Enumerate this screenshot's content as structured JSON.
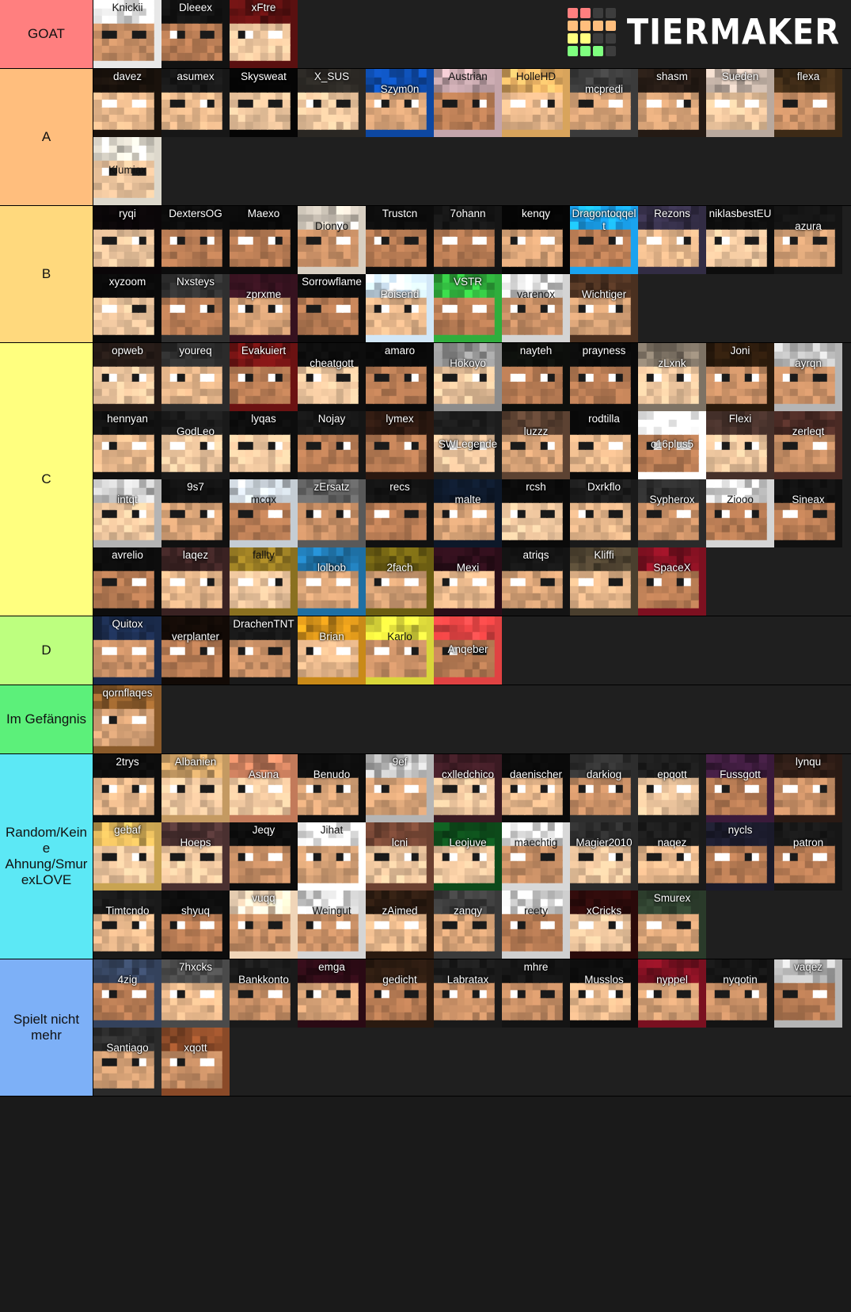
{
  "brand": {
    "name": "TIERMAKER",
    "logo_icon": "tiermaker-grid-logo",
    "logo_colors": [
      "#ff7f7f",
      "#ff7f7f",
      "#3d3d3d",
      "#3d3d3d",
      "#ffbe7d",
      "#ffbe7d",
      "#ffbe7d",
      "#ffbe7d",
      "#ffff7f",
      "#ffff7f",
      "#3d3d3d",
      "#3d3d3d",
      "#7fff7f",
      "#7fff7f",
      "#7fff7f",
      "#3d3d3d"
    ]
  },
  "tiers": [
    {
      "label": "GOAT",
      "color": "#ff7f7f",
      "items": [
        {
          "name": "Knickii",
          "bg": "#e8e8e8",
          "dark": true,
          "skin": "knickii"
        },
        {
          "name": "Dleeex",
          "bg": "#121212",
          "skin": "dleeex"
        },
        {
          "name": "xFtre",
          "bg": "#5a1010",
          "skin": "xftre"
        }
      ]
    },
    {
      "label": "A",
      "color": "#ffbe7d",
      "items": [
        {
          "name": "davez",
          "bg": "#1a120c",
          "skin": "davez"
        },
        {
          "name": "asumex",
          "bg": "#171717",
          "skin": "asumex"
        },
        {
          "name": "Skysweat",
          "bg": "#050505",
          "skin": "skysweat"
        },
        {
          "name": "X_SUS",
          "bg": "#2a2723",
          "skin": "xsus"
        },
        {
          "name": "Szym0n",
          "bg": "#0d47a1",
          "skin": "szymon",
          "pos": "low"
        },
        {
          "name": "Austrian",
          "bg": "#c4a5ab",
          "dark": true,
          "skin": "austrian"
        },
        {
          "name": "HolleHD",
          "bg": "#d8a45c",
          "dark": true,
          "skin": "hollehd"
        },
        {
          "name": "mcpredi",
          "bg": "#3b3b3b",
          "skin": "mcpredi",
          "pos": "low"
        },
        {
          "name": "shasm",
          "bg": "#241a14",
          "skin": "shasm"
        },
        {
          "name": "Sueden",
          "bg": "#b9a99e",
          "skin": "sueden"
        },
        {
          "name": "flexa",
          "bg": "#3d2a16",
          "skin": "flexa"
        },
        {
          "name": "Klumiax",
          "bg": "#ddd8cc",
          "dark": true,
          "skin": "klumiax",
          "pos": "lower"
        }
      ]
    },
    {
      "label": "B",
      "color": "#ffd97d",
      "items": [
        {
          "name": "ryqi",
          "bg": "#0a0608",
          "skin": "ryqi"
        },
        {
          "name": "DextersOG",
          "bg": "#0c0c0c",
          "skin": "dextersog"
        },
        {
          "name": "Maexo",
          "bg": "#090909",
          "skin": "maexo"
        },
        {
          "name": "Dionyo",
          "bg": "#d8cfc2",
          "dark": true,
          "skin": "dionyo",
          "pos": "low"
        },
        {
          "name": "Trustcn",
          "bg": "#0c0c0c",
          "skin": "trustcn"
        },
        {
          "name": "7ohann",
          "bg": "#151515",
          "skin": "7ohann"
        },
        {
          "name": "kenqy",
          "bg": "#050505",
          "skin": "kenqy"
        },
        {
          "name": "Dragontoqqelt",
          "bg": "#1aa3f0",
          "skin": "dragontoqqelt"
        },
        {
          "name": "Rezons",
          "bg": "#322c44",
          "skin": "rezons"
        },
        {
          "name": "niklasbestEU",
          "bg": "#0d0d0d",
          "skin": "niklasbesteu"
        },
        {
          "name": "azura",
          "bg": "#141414",
          "skin": "azura",
          "pos": "low"
        },
        {
          "name": "xyzoom",
          "bg": "#0a0a0a",
          "skin": "xyzoom"
        },
        {
          "name": "Nxsteys",
          "bg": "#2f2f2f",
          "skin": "nxsteys"
        },
        {
          "name": "zprxme",
          "bg": "#36121f",
          "skin": "zprxme",
          "pos": "low"
        },
        {
          "name": "Sorrowflame",
          "bg": "#0b0b0b",
          "skin": "sorrowflame"
        },
        {
          "name": "Poisend",
          "bg": "#d2e7f7",
          "skin": "poisend",
          "pos": "low"
        },
        {
          "name": "VSTR",
          "bg": "#2fae3c",
          "skin": "vstr"
        },
        {
          "name": "varenox",
          "bg": "#d4d4d4",
          "dark": true,
          "skin": "varenox",
          "pos": "low"
        },
        {
          "name": "Wichtiger",
          "bg": "#4a3020",
          "skin": "wichtiger",
          "pos": "low"
        }
      ]
    },
    {
      "label": "C",
      "color": "#ffff7f",
      "items": [
        {
          "name": "opweb",
          "bg": "#241a16",
          "skin": "opweb"
        },
        {
          "name": "youreq",
          "bg": "#2b2b2b",
          "skin": "youreq"
        },
        {
          "name": "Evakuiert",
          "bg": "#6b1212",
          "skin": "evakuiert"
        },
        {
          "name": "cheatgott",
          "bg": "#0d0d0d",
          "skin": "cheatgott",
          "pos": "low"
        },
        {
          "name": "amaro",
          "bg": "#0a0a0a",
          "skin": "amaro"
        },
        {
          "name": "Hokoyo",
          "bg": "#8c8c8c",
          "skin": "hokoyo",
          "pos": "low"
        },
        {
          "name": "nayteh",
          "bg": "#0d0f0c",
          "skin": "nayteh"
        },
        {
          "name": "prayness",
          "bg": "#0a0a0a",
          "skin": "prayness"
        },
        {
          "name": "zLxnk",
          "bg": "#7d7264",
          "skin": "zlxnk",
          "pos": "low"
        },
        {
          "name": "Joni",
          "bg": "#2a1a0c",
          "skin": "joni"
        },
        {
          "name": "ayrqn",
          "bg": "#b5b5b5",
          "skin": "ayrqn",
          "pos": "low"
        },
        {
          "name": "hennyan",
          "bg": "#111111",
          "skin": "hennyan"
        },
        {
          "name": "GodLeo",
          "bg": "#1a1a1a",
          "skin": "godleo",
          "pos": "low"
        },
        {
          "name": "lyqas",
          "bg": "#0d0d0d",
          "skin": "lyqas"
        },
        {
          "name": "Nojay",
          "bg": "#151515",
          "skin": "nojay"
        },
        {
          "name": "lymex",
          "bg": "#2b1810",
          "skin": "lymex"
        },
        {
          "name": "SWLegende",
          "bg": "#1d1d1d",
          "skin": "swlegende",
          "pos": "lower"
        },
        {
          "name": "luzzz",
          "bg": "#5c4232",
          "skin": "luzzz",
          "pos": "low"
        },
        {
          "name": "rodtilla",
          "bg": "#0a0a0a",
          "skin": "rodtilla"
        },
        {
          "name": "c16plus5",
          "bg": "#ffffff",
          "skin": "c16plus5",
          "pos": "lower"
        },
        {
          "name": "Flexi",
          "bg": "#45302a",
          "skin": "flexi"
        },
        {
          "name": "zerleqt",
          "bg": "#4a2a24",
          "skin": "zerleqt",
          "pos": "low"
        },
        {
          "name": "intqt",
          "bg": "#b4b4b4",
          "skin": "intqt",
          "pos": "low"
        },
        {
          "name": "9s7",
          "bg": "#111111",
          "skin": "9s7"
        },
        {
          "name": "mcqx",
          "bg": "#c5cdd4",
          "dark": true,
          "skin": "mcqx",
          "pos": "low"
        },
        {
          "name": "zErsatz",
          "bg": "#595959",
          "skin": "zersatz"
        },
        {
          "name": "recs",
          "bg": "#111111",
          "skin": "recs"
        },
        {
          "name": "malte",
          "bg": "#0d1829",
          "skin": "malte",
          "pos": "low"
        },
        {
          "name": "rcsh",
          "bg": "#0a0a0a",
          "skin": "rcsh"
        },
        {
          "name": "Dxrkflo",
          "bg": "#1a1a1a",
          "skin": "dxrkflo"
        },
        {
          "name": "Sypherox",
          "bg": "#2a2a2a",
          "skin": "sypherox",
          "pos": "low"
        },
        {
          "name": "Ziooo",
          "bg": "#d5d5d5",
          "dark": true,
          "skin": "ziooo",
          "pos": "low"
        },
        {
          "name": "Sineax",
          "bg": "#101010",
          "skin": "sineax",
          "pos": "low"
        },
        {
          "name": "avrelio",
          "bg": "#0d0d0d",
          "skin": "avrelio"
        },
        {
          "name": "laqez",
          "bg": "#3a2222",
          "skin": "laqez"
        },
        {
          "name": "fallty",
          "bg": "#8a7020",
          "dark": true,
          "skin": "fallty"
        },
        {
          "name": "lolbob",
          "bg": "#1e6fa3",
          "skin": "lolbob",
          "pos": "low"
        },
        {
          "name": "2fach",
          "bg": "#6b5d12",
          "skin": "2fach",
          "pos": "low"
        },
        {
          "name": "Mexi",
          "bg": "#2a0d18",
          "skin": "mexi",
          "pos": "low"
        },
        {
          "name": "atriqs",
          "bg": "#141414",
          "skin": "atriqs"
        },
        {
          "name": "Kliffi",
          "bg": "#4a3f2e",
          "skin": "kliffi"
        },
        {
          "name": "SpaceX",
          "bg": "#7d1020",
          "skin": "spacex",
          "pos": "low"
        }
      ]
    },
    {
      "label": "D",
      "color": "#bdff7f",
      "items": [
        {
          "name": "Quitox",
          "bg": "#1a2a4a",
          "skin": "quitox"
        },
        {
          "name": "verplanter",
          "bg": "#120a06",
          "skin": "verplanter",
          "pos": "low"
        },
        {
          "name": "DrachenTNT",
          "bg": "#1a1a1a",
          "skin": "drachentnt"
        },
        {
          "name": "Brian",
          "bg": "#c98a18",
          "skin": "brian",
          "pos": "low"
        },
        {
          "name": "Karlo",
          "bg": "#d9d63a",
          "dark": true,
          "skin": "karlo",
          "pos": "low"
        },
        {
          "name": "Anqeber",
          "bg": "#e04242",
          "skin": "anqeber",
          "pos": "lower"
        }
      ]
    },
    {
      "label": "Im Gefängnis",
      "color": "#5cf07a",
      "items": [
        {
          "name": "qornflaqes",
          "bg": "#8a5a2a",
          "skin": "qornflaqes"
        }
      ]
    },
    {
      "label": "Random/Keine Ahnung/SmurexLOVE",
      "color": "#5ce8f5",
      "items": [
        {
          "name": "2trys",
          "bg": "#0d0d0d",
          "skin": "2trys"
        },
        {
          "name": "Albanien",
          "bg": "#c49a62",
          "skin": "albanien"
        },
        {
          "name": "Asuna",
          "bg": "#c27a5a",
          "skin": "asuna",
          "pos": "low"
        },
        {
          "name": "Benudo",
          "bg": "#0d0d0d",
          "skin": "benudo",
          "pos": "low"
        },
        {
          "name": "9ef",
          "bg": "#b5b5b5",
          "skin": "9ef"
        },
        {
          "name": "cxlledchico",
          "bg": "#3a1a22",
          "skin": "cxlledchico",
          "pos": "low"
        },
        {
          "name": "daenischer",
          "bg": "#0a0a0a",
          "skin": "daenischer",
          "pos": "low"
        },
        {
          "name": "darkiog",
          "bg": "#2d2d2d",
          "skin": "darkiog",
          "pos": "low"
        },
        {
          "name": "epqott",
          "bg": "#1a1a1a",
          "skin": "epqott",
          "pos": "low"
        },
        {
          "name": "Fussgott",
          "bg": "#3a1a3a",
          "skin": "fussgott",
          "pos": "low"
        },
        {
          "name": "lynqu",
          "bg": "#2a1a14",
          "skin": "lynqu"
        },
        {
          "name": "gebaf",
          "bg": "#c9a452",
          "skin": "gebaf"
        },
        {
          "name": "Hoeps",
          "bg": "#4a3030",
          "skin": "hoeps",
          "pos": "low"
        },
        {
          "name": "Jeqy",
          "bg": "#0d0d0d",
          "skin": "jeqy"
        },
        {
          "name": "Jihat",
          "bg": "#ffffff",
          "dark": true,
          "skin": "jihat"
        },
        {
          "name": "lcni",
          "bg": "#6b4030",
          "skin": "lcni",
          "pos": "low"
        },
        {
          "name": "Leojuve",
          "bg": "#0d4a1a",
          "skin": "leojuve",
          "pos": "low"
        },
        {
          "name": "maechtig",
          "bg": "#d8d8d8",
          "dark": true,
          "skin": "maechtig",
          "pos": "low"
        },
        {
          "name": "Magier2010",
          "bg": "#2a2a2a",
          "skin": "magier2010",
          "pos": "low"
        },
        {
          "name": "naqez",
          "bg": "#1a1a1a",
          "skin": "naqez",
          "pos": "low"
        },
        {
          "name": "nycls",
          "bg": "#1a1a2a",
          "skin": "nycls"
        },
        {
          "name": "patron",
          "bg": "#161616",
          "skin": "patron",
          "pos": "low"
        },
        {
          "name": "Timtcndo",
          "bg": "#1a1a1a",
          "skin": "timtcndo",
          "pos": "low"
        },
        {
          "name": "shyuq",
          "bg": "#0d0d0d",
          "skin": "shyuq",
          "pos": "low"
        },
        {
          "name": "vuqq",
          "bg": "#f0d5b8",
          "skin": "vuqq"
        },
        {
          "name": "Weingut",
          "bg": "#d5d5d5",
          "dark": true,
          "skin": "weingut",
          "pos": "low"
        },
        {
          "name": "zAimed",
          "bg": "#2a1a10",
          "skin": "zaimed",
          "pos": "low"
        },
        {
          "name": "zanqy",
          "bg": "#3a3a3a",
          "skin": "zanqy",
          "pos": "low"
        },
        {
          "name": "reety",
          "bg": "#cfcfcf",
          "dark": true,
          "skin": "reety",
          "pos": "low"
        },
        {
          "name": "xCricks",
          "bg": "#2a0a0a",
          "skin": "xcricks",
          "pos": "low"
        },
        {
          "name": "Smurex",
          "bg": "#2a3a2a",
          "skin": "smurex"
        }
      ]
    },
    {
      "label": "Spielt nicht mehr",
      "color": "#7db0f7",
      "items": [
        {
          "name": "4zig",
          "bg": "#34425c",
          "skin": "4zig",
          "pos": "low"
        },
        {
          "name": "7hxcks",
          "bg": "#4a4a4a",
          "skin": "7hxcks"
        },
        {
          "name": "Bankkonto",
          "bg": "#1a1a1a",
          "skin": "bankkonto",
          "pos": "low"
        },
        {
          "name": "emga",
          "bg": "#2a0a14",
          "skin": "emga"
        },
        {
          "name": "gedicht",
          "bg": "#2a1a10",
          "skin": "gedicht",
          "pos": "low"
        },
        {
          "name": "Labratax",
          "bg": "#1a1a1a",
          "skin": "labratax",
          "pos": "low"
        },
        {
          "name": "mhre",
          "bg": "#141414",
          "skin": "mhre"
        },
        {
          "name": "Musslos",
          "bg": "#0d0d0d",
          "skin": "musslos",
          "pos": "low"
        },
        {
          "name": "nyppel",
          "bg": "#7a1020",
          "skin": "nyppel",
          "pos": "low"
        },
        {
          "name": "nyqotin",
          "bg": "#141414",
          "skin": "nyqotin",
          "pos": "low"
        },
        {
          "name": "vaqez",
          "bg": "#b5b5b5",
          "skin": "vaqez"
        },
        {
          "name": "Santiago",
          "bg": "#2a2a2a",
          "skin": "santiago",
          "pos": "low"
        },
        {
          "name": "xqott",
          "bg": "#8a4a28",
          "skin": "xqott",
          "pos": "low"
        }
      ]
    }
  ]
}
